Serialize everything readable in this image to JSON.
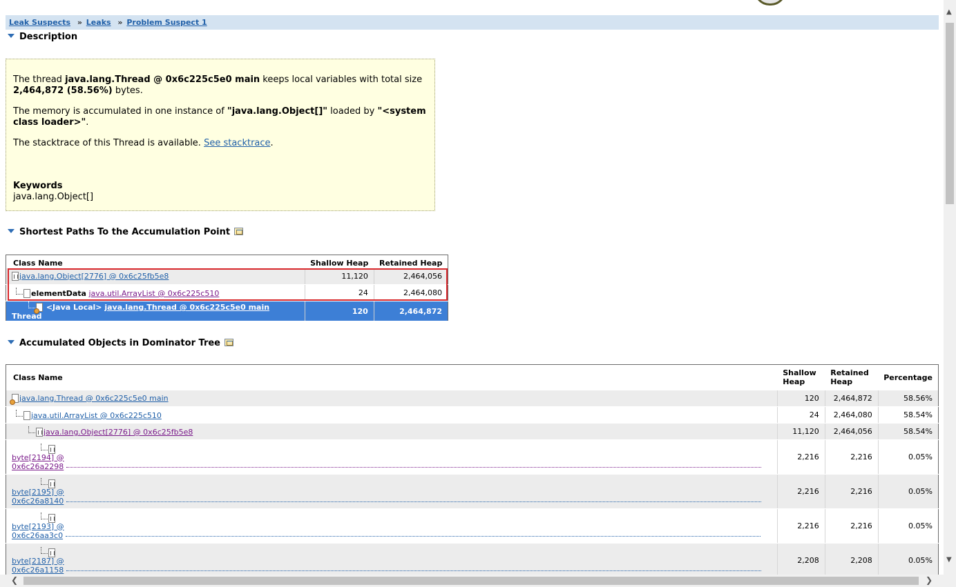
{
  "breadcrumb": [
    {
      "label": "Leak Suspects"
    },
    {
      "sep": "»",
      "label": "Leaks"
    },
    {
      "sep": "»",
      "label": "Problem Suspect 1"
    }
  ],
  "description": {
    "title": "Description",
    "p1_pre": "The thread ",
    "p1_thread": "java.lang.Thread @ 0x6c225c5e0 main",
    "p1_mid": " keeps local variables with total size ",
    "p1_size": "2,464,872 (58.56%)",
    "p1_post": " bytes.",
    "p2_pre": "The memory is accumulated in one instance of ",
    "p2_class": "\"java.lang.Object[]\"",
    "p2_mid": " loaded by ",
    "p2_loader": "\"<system class loader>\"",
    "p2_post": ".",
    "p3_pre": "The stacktrace of this Thread is available. ",
    "p3_link": "See stacktrace",
    "p3_post": ".",
    "keywords_title": "Keywords",
    "keywords_value": "java.lang.Object[]"
  },
  "paths": {
    "title": "Shortest Paths To the Accumulation Point",
    "headers": {
      "class_name": "Class Name",
      "shallow": "Shallow Heap",
      "retained": "Retained Heap"
    },
    "rows": [
      {
        "field": "",
        "link": "java.lang.Object[2776] @ 0x6c25fb5e8",
        "suffix": "",
        "shallow": "11,120",
        "retained": "2,464,056"
      },
      {
        "field": "elementData",
        "link": "java.util.ArrayList @ 0x6c225c510",
        "suffix": "",
        "shallow": "24",
        "retained": "2,464,080"
      },
      {
        "field": "<Java Local>",
        "link": "java.lang.Thread @ 0x6c225c5e0 main",
        "suffix": "Thread",
        "shallow": "120",
        "retained": "2,464,872"
      }
    ]
  },
  "dominator": {
    "title": "Accumulated Objects in Dominator Tree",
    "headers": {
      "class_name": "Class Name",
      "shallow_1": "Shallow",
      "shallow_2": "Heap",
      "retained_1": "Retained",
      "retained_2": "Heap",
      "percentage": "Percentage"
    },
    "rows": [
      {
        "link": "java.lang.Thread @ 0x6c225c5e0 main",
        "shallow": "120",
        "retained": "2,464,872",
        "pct": "58.56%"
      },
      {
        "link": "java.util.ArrayList @ 0x6c225c510",
        "shallow": "24",
        "retained": "2,464,080",
        "pct": "58.54%"
      },
      {
        "link": "java.lang.Object[2776] @ 0x6c25fb5e8",
        "shallow": "11,120",
        "retained": "2,464,056",
        "pct": "58.54%"
      },
      {
        "link1": "byte[2194] @",
        "link2": "0x6c26a2298",
        "shallow": "2,216",
        "retained": "2,216",
        "pct": "0.05%"
      },
      {
        "link1": "byte[2195] @",
        "link2": "0x6c26a8140",
        "shallow": "2,216",
        "retained": "2,216",
        "pct": "0.05%"
      },
      {
        "link1": "byte[2193] @",
        "link2": "0x6c26aa3c0",
        "shallow": "2,216",
        "retained": "2,216",
        "pct": "0.05%"
      },
      {
        "link1": "byte[2187] @",
        "link2": "0x6c26a1158",
        "shallow": "2,208",
        "retained": "2,208",
        "pct": "0.05%"
      }
    ]
  },
  "icons": {
    "collapse": "triangle-down-icon",
    "table": "table-view-icon",
    "object": "object-file-icon",
    "thread": "thread-icon"
  }
}
